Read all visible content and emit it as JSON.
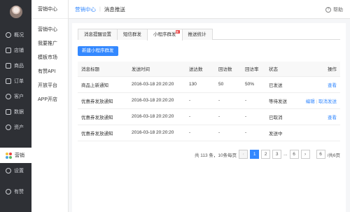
{
  "sidebar": {
    "items": [
      {
        "label": "概况",
        "icon": "overview-icon"
      },
      {
        "label": "店铺",
        "icon": "shop-icon"
      },
      {
        "label": "商品",
        "icon": "goods-icon"
      },
      {
        "label": "订单",
        "icon": "order-icon"
      },
      {
        "label": "客户",
        "icon": "customer-icon"
      },
      {
        "label": "数据",
        "icon": "data-icon"
      },
      {
        "label": "资产",
        "icon": "asset-icon"
      }
    ],
    "active": {
      "label": "营销",
      "icon": "marketing-icon"
    },
    "settings": {
      "label": "设置"
    },
    "bottom": {
      "label": "有赞"
    }
  },
  "subnav": {
    "title": "营销中心",
    "items": [
      "营销中心",
      "我要推广",
      "模板市场",
      "有赞API",
      "开放平台",
      "APP开店"
    ]
  },
  "header": {
    "crumb_parent": "营销中心",
    "crumb_current": "消息推送",
    "help": "帮助"
  },
  "tabs": [
    {
      "label": "消息提醒设置"
    },
    {
      "label": "短信群发"
    },
    {
      "label": "小程序群发",
      "badge": "新"
    },
    {
      "label": "推送统计"
    }
  ],
  "new_button": "新建小程序群发",
  "table": {
    "headers": [
      "消息标题",
      "发送时间",
      "送达数",
      "回访数",
      "回访率",
      "状态",
      "操作"
    ],
    "rows": [
      {
        "title": "商品上新通知",
        "time": "2016-03-18 20:20:20",
        "delivered": "130",
        "visits": "50",
        "rate": "50%",
        "status": "已发送",
        "ops": [
          "查看"
        ]
      },
      {
        "title": "优惠券发放通知",
        "time": "2016-03-18 20:20:20",
        "delivered": "-",
        "visits": "-",
        "rate": "-",
        "status": "等待发送",
        "ops": [
          "编辑",
          "取消发送"
        ]
      },
      {
        "title": "优惠券发放通知",
        "time": "2016-03-18 20:20:20",
        "delivered": "-",
        "visits": "-",
        "rate": "-",
        "status": "已取消",
        "ops": [
          "查看"
        ]
      },
      {
        "title": "优惠券发放通知",
        "time": "2016-03-18 20:20:20",
        "delivered": "-",
        "visits": "-",
        "rate": "-",
        "status": "发送中",
        "ops": []
      }
    ]
  },
  "pager": {
    "summary": "共 113 条，10条每页",
    "prev": "‹",
    "pages": [
      "1",
      "2",
      "3",
      "...",
      "6"
    ],
    "next": "›",
    "jump_value": "6",
    "total_pages": "/共6页"
  },
  "colors": {
    "accent": "#3388ff",
    "sidebar_bg": "#2e3035"
  }
}
